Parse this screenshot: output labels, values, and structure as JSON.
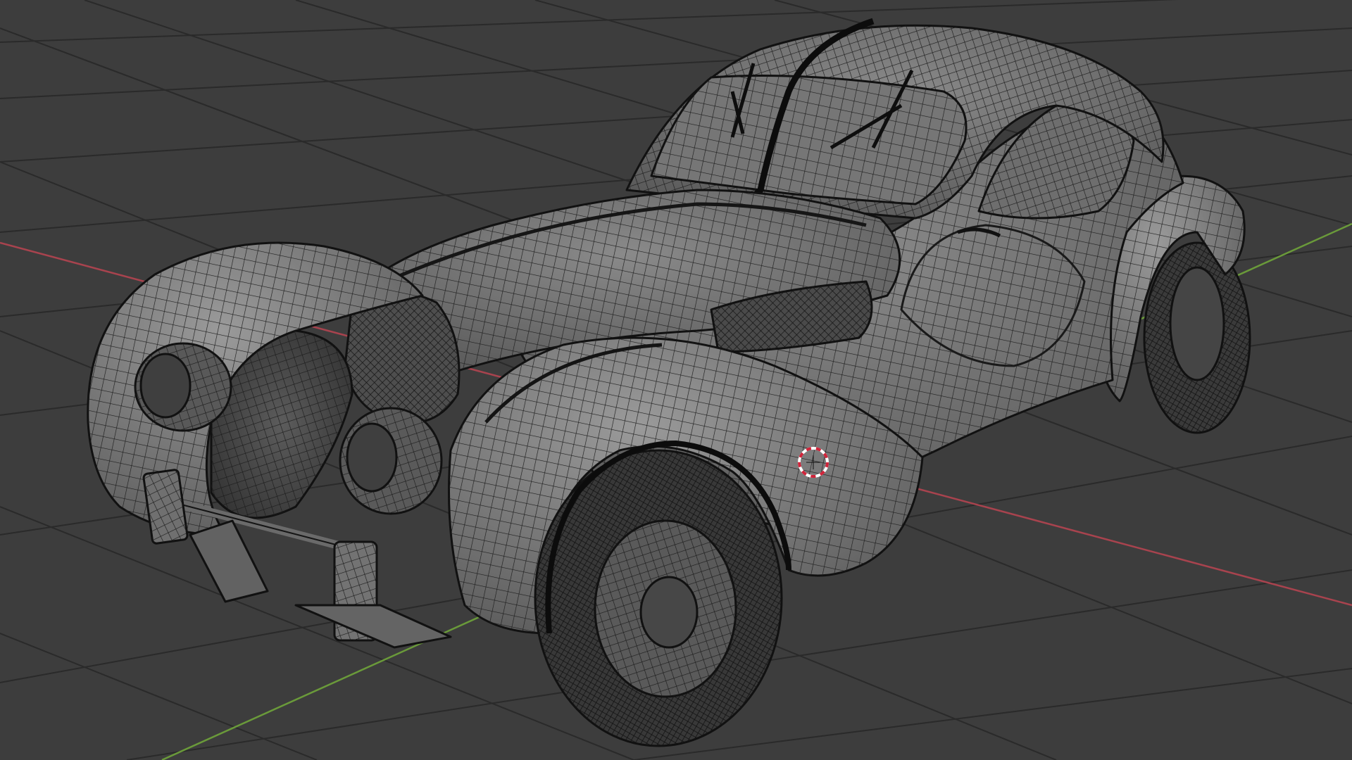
{
  "viewport": {
    "name": "3D Viewport",
    "shading": "solid-wireframe",
    "background_color": "#3d3d3d",
    "grid_color": "#2a2a2a",
    "x_axis_color": "#a8434e",
    "y_axis_color": "#6a9a3a",
    "object": "car-mesh",
    "cursor": "3d-cursor"
  }
}
